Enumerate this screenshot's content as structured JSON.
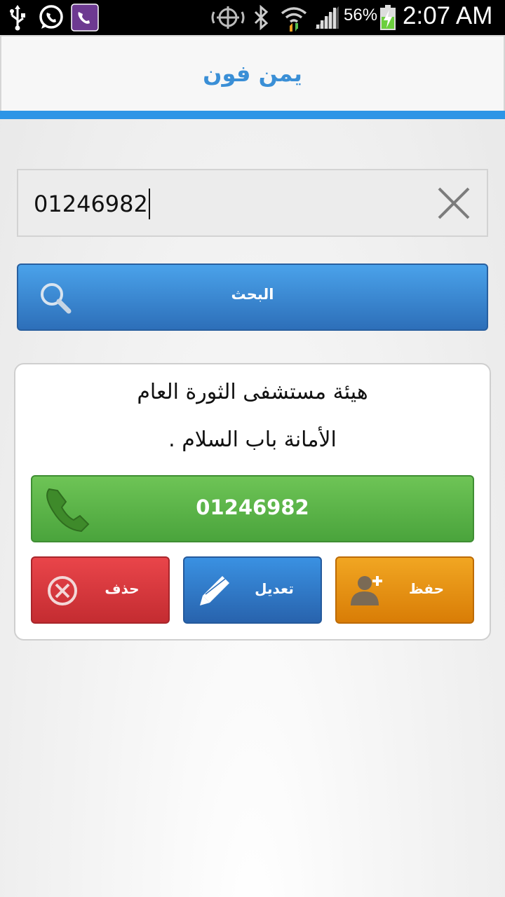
{
  "status_bar": {
    "battery_percent": "56%",
    "time": "2:07 AM",
    "icons": [
      "usb-icon",
      "whatsapp-icon",
      "viber-icon",
      "sync-icon",
      "bluetooth-icon",
      "wifi-icon",
      "signal-icon",
      "battery-charging-icon"
    ]
  },
  "app": {
    "title": "يمن فون",
    "accent_color": "#2e95e6"
  },
  "search": {
    "value": "01246982",
    "button_label": "البحث"
  },
  "result": {
    "name": "هيئة مستشفى الثورة العام",
    "address": "الأمانة باب السلام .",
    "phone": "01246982"
  },
  "actions": {
    "delete_label": "حذف",
    "edit_label": "تعديل",
    "save_label": "حفظ"
  }
}
